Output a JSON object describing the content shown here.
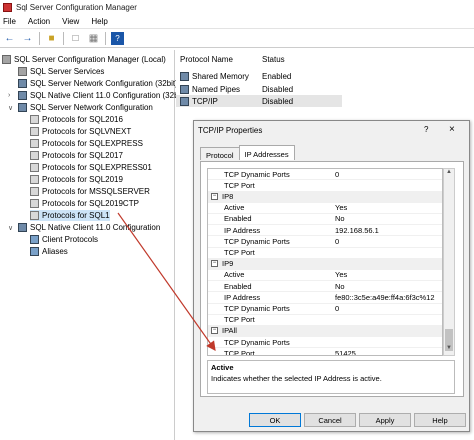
{
  "window": {
    "title": "Sql Server Configuration Manager"
  },
  "menu": [
    "File",
    "Action",
    "View",
    "Help"
  ],
  "toolbar": {
    "icons": [
      "back-icon",
      "forward-icon",
      "folder-up-icon",
      "properties-icon",
      "export-icon",
      "help-icon"
    ]
  },
  "tree": [
    {
      "label": "SQL Server Configuration Manager (Local)",
      "icon": "server",
      "level": 0,
      "expander": ""
    },
    {
      "label": "SQL Server Services",
      "icon": "server",
      "level": 1,
      "expander": ""
    },
    {
      "label": "SQL Server Network Configuration (32bit)",
      "icon": "net",
      "level": 1,
      "expander": ""
    },
    {
      "label": "SQL Native Client 11.0 Configuration (32bit)",
      "icon": "net",
      "level": 1,
      "expander": ">"
    },
    {
      "label": "SQL Server Network Configuration",
      "icon": "net",
      "level": 1,
      "expander": "v"
    },
    {
      "label": "Protocols for SQL2016",
      "icon": "proto",
      "level": 2,
      "expander": ""
    },
    {
      "label": "Protocols for SQLVNEXT",
      "icon": "proto",
      "level": 2,
      "expander": ""
    },
    {
      "label": "Protocols for SQLEXPRESS",
      "icon": "proto",
      "level": 2,
      "expander": ""
    },
    {
      "label": "Protocols for SQL2017",
      "icon": "proto",
      "level": 2,
      "expander": ""
    },
    {
      "label": "Protocols for SQLEXPRESS01",
      "icon": "proto",
      "level": 2,
      "expander": ""
    },
    {
      "label": "Protocols for SQL2019",
      "icon": "proto",
      "level": 2,
      "expander": ""
    },
    {
      "label": "Protocols for MSSQLSERVER",
      "icon": "proto",
      "level": 2,
      "expander": ""
    },
    {
      "label": "Protocols for SQL2019CTP",
      "icon": "proto",
      "level": 2,
      "expander": ""
    },
    {
      "label": "Protocols for SQL1",
      "icon": "proto",
      "level": 2,
      "expander": "",
      "selected": true
    },
    {
      "label": "SQL Native Client 11.0 Configuration",
      "icon": "net",
      "level": 1,
      "expander": "v"
    },
    {
      "label": "Client Protocols",
      "icon": "client",
      "level": 2,
      "expander": ""
    },
    {
      "label": "Aliases",
      "icon": "client",
      "level": 2,
      "expander": ""
    }
  ],
  "list": {
    "headers": [
      "Protocol Name",
      "Status"
    ],
    "rows": [
      {
        "name": "Shared Memory",
        "status": "Enabled"
      },
      {
        "name": "Named Pipes",
        "status": "Disabled"
      },
      {
        "name": "TCP/IP",
        "status": "Disabled"
      }
    ]
  },
  "dialog": {
    "title": "TCP/IP Properties",
    "help": "?",
    "close": "×",
    "tabs": [
      "Protocol",
      "IP Addresses"
    ],
    "grid": [
      {
        "type": "prop",
        "key": "TCP Dynamic Ports",
        "value": "0"
      },
      {
        "type": "prop",
        "key": "TCP Port",
        "value": ""
      },
      {
        "type": "sec",
        "key": "IP8",
        "sign": "−"
      },
      {
        "type": "prop",
        "key": "Active",
        "value": "Yes"
      },
      {
        "type": "prop",
        "key": "Enabled",
        "value": "No"
      },
      {
        "type": "prop",
        "key": "IP Address",
        "value": "192.168.56.1"
      },
      {
        "type": "prop",
        "key": "TCP Dynamic Ports",
        "value": "0"
      },
      {
        "type": "prop",
        "key": "TCP Port",
        "value": ""
      },
      {
        "type": "sec",
        "key": "IP9",
        "sign": "−"
      },
      {
        "type": "prop",
        "key": "Active",
        "value": "Yes"
      },
      {
        "type": "prop",
        "key": "Enabled",
        "value": "No"
      },
      {
        "type": "prop",
        "key": "IP Address",
        "value": "fe80::3c5e:a49e:ff4a:6f3c%12"
      },
      {
        "type": "prop",
        "key": "TCP Dynamic Ports",
        "value": "0"
      },
      {
        "type": "prop",
        "key": "TCP Port",
        "value": ""
      },
      {
        "type": "sec",
        "key": "IPAll",
        "sign": "−"
      },
      {
        "type": "prop",
        "key": "TCP Dynamic Ports",
        "value": ""
      },
      {
        "type": "prop",
        "key": "TCP Port",
        "value": "51425"
      }
    ],
    "description": {
      "heading": "Active",
      "text": "Indicates whether the selected IP Address is active."
    },
    "buttons": [
      "OK",
      "Cancel",
      "Apply",
      "Help"
    ]
  },
  "colors": {
    "arrow": "#c0392b",
    "selection": "#cde4f7"
  }
}
